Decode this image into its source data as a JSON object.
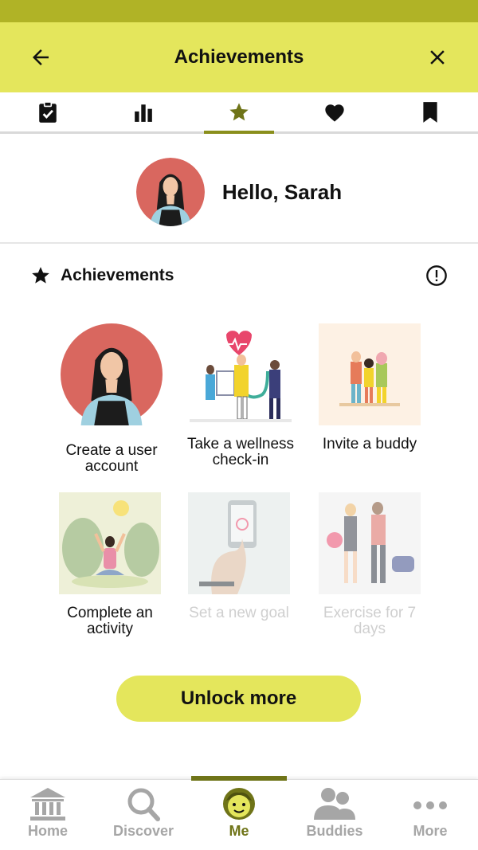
{
  "header": {
    "title": "Achievements",
    "back_icon": "arrow-left-icon",
    "close_icon": "close-icon"
  },
  "tabs": [
    {
      "name": "checklist",
      "icon": "clipboard-check-icon",
      "active": false
    },
    {
      "name": "stats",
      "icon": "bar-chart-icon",
      "active": false
    },
    {
      "name": "achievements",
      "icon": "star-icon",
      "active": true
    },
    {
      "name": "favorites",
      "icon": "heart-icon",
      "active": false
    },
    {
      "name": "saved",
      "icon": "bookmark-icon",
      "active": false
    }
  ],
  "profile": {
    "greeting": "Hello, Sarah"
  },
  "achievements": {
    "label": "Achievements",
    "items": [
      {
        "caption": "Create a user account",
        "unlocked": true
      },
      {
        "caption": "Take a wellness check-in",
        "unlocked": true
      },
      {
        "caption": "Invite a buddy",
        "unlocked": true
      },
      {
        "caption": "Complete an activity",
        "unlocked": true
      },
      {
        "caption": "Set a new goal",
        "unlocked": false
      },
      {
        "caption": "Exercise for 7 days",
        "unlocked": false
      }
    ]
  },
  "unlock_button": "Unlock more",
  "nav": [
    {
      "label": "Home",
      "icon": "bank-icon",
      "active": false
    },
    {
      "label": "Discover",
      "icon": "search-icon",
      "active": false
    },
    {
      "label": "Me",
      "icon": "face-icon",
      "active": true
    },
    {
      "label": "Buddies",
      "icon": "people-icon",
      "active": false
    },
    {
      "label": "More",
      "icon": "more-dots-icon",
      "active": false
    }
  ],
  "colors": {
    "brand": "#e4e65c",
    "brand_dark": "#6f7418",
    "status": "#b0b326",
    "avatar_bg": "#d9675f"
  }
}
